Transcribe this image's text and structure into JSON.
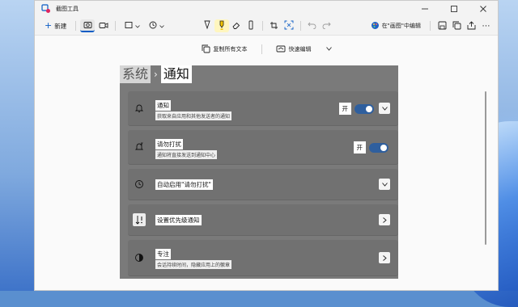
{
  "window": {
    "title": "截图工具"
  },
  "toolbar": {
    "new_label": "新建",
    "paint_label": "在\"画图\"中编辑"
  },
  "actions": {
    "copy_text": "复制所有文本",
    "quick_edit": "快速编辑"
  },
  "screenshot": {
    "breadcrumb_parent": "系统",
    "breadcrumb_sep": "›",
    "breadcrumb_current": "通知",
    "rows": [
      {
        "title": "通知",
        "subtitle": "获取来自应用和其他发送者的通知",
        "toggle": "开",
        "toggle_on": true
      },
      {
        "title": "请勿打扰",
        "subtitle": "通知将直接发送到通知中心",
        "toggle": "开",
        "toggle_on": true
      },
      {
        "title": "自动启用\"请勿打扰\""
      },
      {
        "title": "设置优先级通知"
      },
      {
        "title": "专注",
        "subtitle": "会话持续时间，隐藏应用上的徽章"
      }
    ]
  },
  "colors": {
    "accent": "#0a5bc4",
    "toggle_on": "#2f5f9e"
  }
}
